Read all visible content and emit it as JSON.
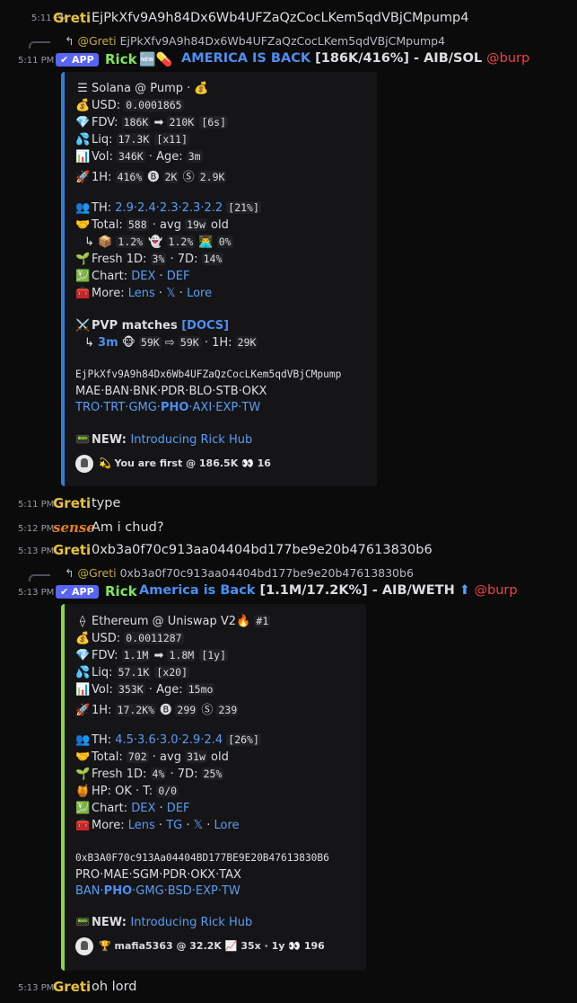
{
  "messages": {
    "m1": {
      "time": "5:11 PM",
      "author": "Greti",
      "text": "EjPkXfv9A9h84Dx6Wb4UFZaQzCocLKem5qdVBjCMpump4"
    },
    "m2": {
      "reply": {
        "arrow": "↰",
        "name": "@Greti",
        "text": "EjPkXfv9A9h84Dx6Wb4UFZaQzCocLKem5qdVBjCMpump4"
      },
      "time": "5:11 PM",
      "app_badge": "APP",
      "author": "Rick",
      "badge_icon": "🆕💊",
      "title_link": "AMERICA IS BACK",
      "title_rest": " [186K/416%] - AIB/SOL ",
      "mention": "@burp",
      "embed": {
        "l1": {
          "icon": "☰",
          "text": "Solana @ Pump · ",
          "icon2": "💰"
        },
        "l2": {
          "icon": "💰",
          "label": "USD: ",
          "v1": "0.0001865"
        },
        "l3": {
          "icon": "💎",
          "label": "FDV: ",
          "v1": "186K",
          "arrow": " ➡ ",
          "v2": "210K",
          "v3": "[6s]"
        },
        "l4": {
          "icon": "💦",
          "label": "Liq: ",
          "v1": "17.3K",
          "v2": "[x11]"
        },
        "l5": {
          "icon": "📊",
          "label": "Vol: ",
          "v1": "346K",
          "mid": " · Age: ",
          "v2": "3m"
        },
        "l6": {
          "icon": "🚀",
          "label": "1H: ",
          "v1": "416%",
          "i1": "🅑",
          "v2": "2K",
          "i2": "Ⓢ",
          "v3": "2.9K"
        },
        "l7": {
          "icon": "👥",
          "label": "TH: ",
          "links": "2.9·2.4·2.3·2.3·2.2",
          "v1": "[21%]"
        },
        "l8": {
          "icon": "🤝",
          "label": "Total: ",
          "v1": "588",
          "mid": " · avg ",
          "v2": "19w",
          "tail": " old"
        },
        "l9": {
          "prefix": "↳",
          "i1": "📦",
          "v1": "1.2%",
          "i2": "👻",
          "v2": "1.2%",
          "i3": "👨‍💻",
          "v3": "0%"
        },
        "l10": {
          "icon": "🌱",
          "label": "Fresh 1D: ",
          "v1": "3%",
          "mid": " · 7D: ",
          "v2": "14%"
        },
        "l11": {
          "icon": "💹",
          "label": "Chart: ",
          "a": "DEX",
          "sep": " · ",
          "b": "DEF"
        },
        "l12": {
          "icon": "🧰",
          "label": "More: ",
          "a": "Lens",
          "sep1": " · ",
          "b": "𝕏",
          "sep2": " · ",
          "c": "Lore"
        },
        "l13": {
          "icon": "⚔️",
          "label": "PVP matches ",
          "link": "[DOCS]"
        },
        "l14": {
          "prefix": "↳",
          "link": "3m",
          "i1": "🐵",
          "v1": "59K",
          "arrow": " ⇨ ",
          "v2": "59K",
          "mid": " · 1H: ",
          "v3": "29K"
        },
        "contract": "EjPkXfv9A9h84Dx6Wb4UFZaQzCocLKem5qdVBjCMpump",
        "chains1": "MAE·BAN·BNK·PDR·BLO·STB·OKX",
        "chains2a": "TRO·TRT·GMG·",
        "chains2b": "PHO",
        "chains2c": "·AXI·EXP·TW",
        "new_icon": "📟",
        "new_label": "NEW: ",
        "new_link": "Introducing Rick Hub",
        "footer_icon": "💫",
        "footer_text": "You are first @ 186.5K",
        "footer_icon2": "👀",
        "footer_count": "16"
      }
    },
    "m3": {
      "time": "5:11 PM",
      "author": "Greti",
      "text": "type"
    },
    "m4": {
      "time": "5:12 PM",
      "author": "sense",
      "text": "Am i chud?"
    },
    "m5": {
      "time": "5:13 PM",
      "author": "Greti",
      "text": "0xb3a0f70c913aa04404bd177be9e20b47613830b6"
    },
    "m6": {
      "reply": {
        "arrow": "↰",
        "name": "@Greti",
        "text": "0xb3a0f70c913aa04404bd177be9e20b47613830b6"
      },
      "time": "5:13 PM",
      "app_badge": "APP",
      "author": "Rick",
      "title_link": "America is Back",
      "title_rest": " [1.1M/17.2K%] - AIB/WETH ",
      "up_icon": "⬆",
      "mention": "@burp",
      "embed": {
        "l1": {
          "icon": "⟠",
          "text": "Ethereum @ Uniswap V2",
          "icon2": "🔥",
          "rank": "#1"
        },
        "l2": {
          "icon": "💰",
          "label": "USD: ",
          "v1": "0.0011287"
        },
        "l3": {
          "icon": "💎",
          "label": "FDV: ",
          "v1": "1.1M",
          "arrow": " ➡ ",
          "v2": "1.8M",
          "v3": "[1y]"
        },
        "l4": {
          "icon": "💦",
          "label": "Liq: ",
          "v1": "57.1K",
          "v2": "[x20]"
        },
        "l5": {
          "icon": "📊",
          "label": "Vol: ",
          "v1": "353K",
          "mid": " · Age: ",
          "v2": "15mo"
        },
        "l6": {
          "icon": "🚀",
          "label": "1H: ",
          "v1": "17.2K%",
          "i1": "🅑",
          "v2": "299",
          "i2": "Ⓢ",
          "v3": "239"
        },
        "l7": {
          "icon": "👥",
          "label": "TH: ",
          "links": "4.5·3.6·3.0·2.9·2.4",
          "v1": "[26%]"
        },
        "l8": {
          "icon": "🤝",
          "label": "Total: ",
          "v1": "702",
          "mid": " · avg ",
          "v2": "31w",
          "tail": " old"
        },
        "l9": {
          "icon": "🌱",
          "label": "Fresh 1D: ",
          "v1": "4%",
          "mid": " · 7D: ",
          "v2": "25%"
        },
        "l10": {
          "icon": "🍯",
          "label": "HP: OK · T: ",
          "v1": "0/0"
        },
        "l11": {
          "icon": "💹",
          "label": "Chart: ",
          "a": "DEX",
          "sep": " · ",
          "b": "DEF"
        },
        "l12": {
          "icon": "🧰",
          "label": "More: ",
          "a": "Lens",
          "sep1": " · ",
          "b": "TG",
          "sep2": " · ",
          "c": "𝕏",
          "sep3": " · ",
          "d": "Lore"
        },
        "contract": "0xB3A0F70c913Aa04404BD177BE9E20B47613830B6",
        "chains1": "PRO·MAE·SGM·PDR·OKX·TAX",
        "chains2a": "BAN·",
        "chains2b": "PHO",
        "chains2c": "·GMG·BSD·EXP·TW",
        "new_icon": "📟",
        "new_label": "NEW: ",
        "new_link": "Introducing Rick Hub",
        "footer_icon": "🏆",
        "footer_text": "mafia5363 @ 32.2K",
        "footer_icon2": "📈",
        "footer_text2": "35x · 1y",
        "footer_icon3": "👀",
        "footer_count": "196"
      }
    },
    "m7": {
      "time": "5:13 PM",
      "author": "Greti",
      "text": "oh lord"
    }
  },
  "colors": {
    "accent_embed1": "#2f7fd6",
    "accent_embed2": "#8bd44a",
    "greti": "#e6c13c",
    "rick": "#80e55e",
    "mention": "#ef4444",
    "link": "#5b9cf5"
  }
}
